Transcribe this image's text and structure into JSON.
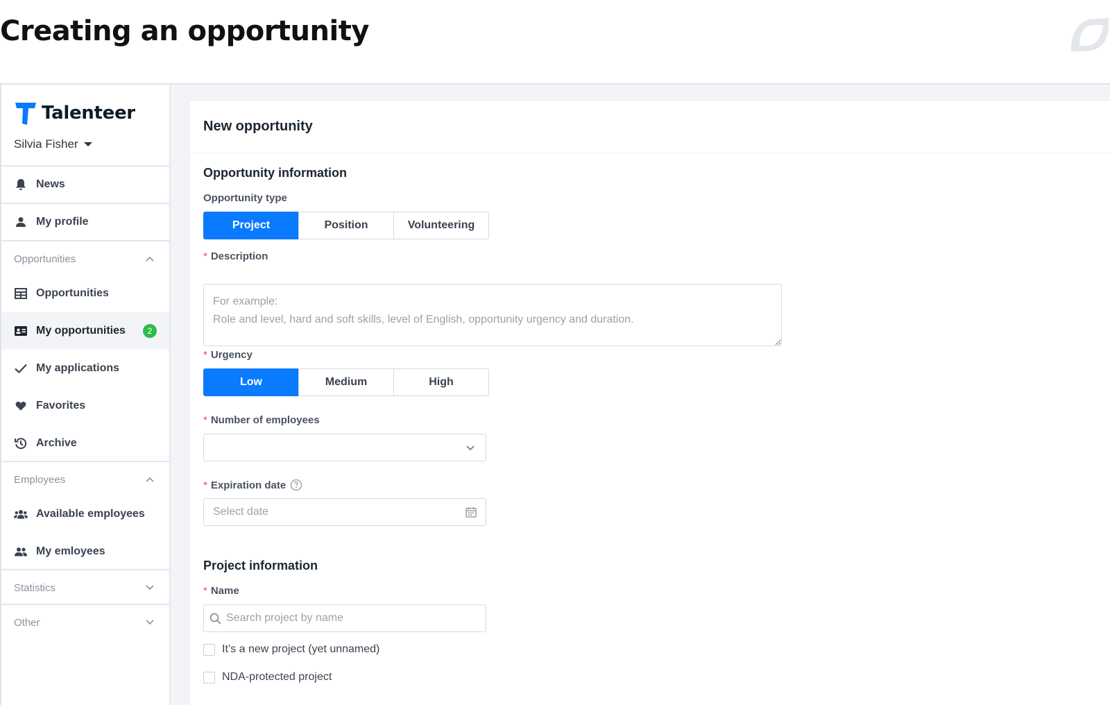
{
  "slide": {
    "title": "Creating an opportunity"
  },
  "app": {
    "name": "Talenteer",
    "user": "Silvia Fisher",
    "accent": "#0a7aff",
    "badge_color": "#2dbb4e"
  },
  "sidebar": {
    "news": "News",
    "my_profile": "My profile",
    "groups": {
      "opportunities": "Opportunities",
      "employees": "Employees",
      "statistics": "Statistics",
      "other": "Other"
    },
    "opportunities": "Opportunities",
    "my_opportunities": "My opportunities",
    "my_opportunities_count": "2",
    "my_applications": "My applications",
    "favorites": "Favorites",
    "archive": "Archive",
    "available_employees": "Available employees",
    "my_employees": "My emloyees"
  },
  "form": {
    "page_title": "New opportunity",
    "opportunity_info_title": "Opportunity information",
    "opportunity_type_label": "Opportunity type",
    "opportunity_types": [
      "Project",
      "Position",
      "Volunteering"
    ],
    "opportunity_type_selected": "Project",
    "description_label": "Description",
    "description_placeholder": "For example:\nRole and level, hard and soft skills, level of English, opportunity urgency and duration.",
    "urgency_label": "Urgency",
    "urgency_options": [
      "Low",
      "Medium",
      "High"
    ],
    "urgency_selected": "Low",
    "employees_label": "Number of employees",
    "employees_value": "",
    "expiration_label": "Expiration date",
    "expiration_placeholder": "Select date",
    "project_info_title": "Project information",
    "name_label": "Name",
    "name_placeholder": "Search project by name",
    "new_project_label": "It’s a new project (yet unnamed)",
    "nda_label": "NDA-protected project"
  }
}
